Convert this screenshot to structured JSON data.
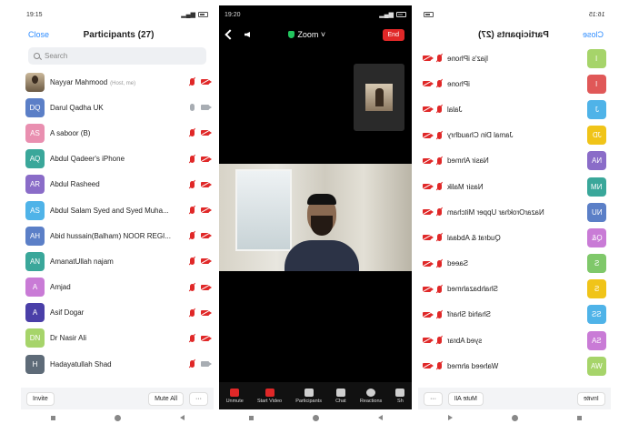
{
  "panel1": {
    "status": {
      "time": "19:15"
    },
    "header": {
      "close": "Close",
      "title": "Participants (27)"
    },
    "search": {
      "placeholder": "Search"
    },
    "participants": [
      {
        "name": "Nayyar Mahmood",
        "host": "(Host, me)",
        "initials": "",
        "color": "",
        "mic": "muted",
        "cam": "off"
      },
      {
        "name": "Darul Qadha UK",
        "initials": "DQ",
        "color": "#5b7fc7",
        "mic": "on",
        "cam": "on"
      },
      {
        "name": "A saboor (B)",
        "initials": "AS",
        "color": "#e98fb0",
        "mic": "muted",
        "cam": "off"
      },
      {
        "name": "Abdul Qadeer's iPhone",
        "initials": "AQ",
        "color": "#3aa79a",
        "mic": "muted",
        "cam": "off"
      },
      {
        "name": "Abdul Rasheed",
        "initials": "AR",
        "color": "#8a6cc8",
        "mic": "muted",
        "cam": "off"
      },
      {
        "name": "Abdul Salam Syed and Syed Muha...",
        "initials": "AS",
        "color": "#4fb3e8",
        "mic": "muted",
        "cam": "off"
      },
      {
        "name": "Abid hussain(Balham) NOOR REGI...",
        "initials": "AH",
        "color": "#5b7fc7",
        "mic": "muted",
        "cam": "off"
      },
      {
        "name": "AmanatUllah najam",
        "initials": "AN",
        "color": "#3aa79a",
        "mic": "muted",
        "cam": "off"
      },
      {
        "name": "Amjad",
        "initials": "A",
        "color": "#c97bd6",
        "mic": "muted",
        "cam": "off"
      },
      {
        "name": "Asif Dogar",
        "initials": "A",
        "color": "#4a3fa8",
        "mic": "muted",
        "cam": "off"
      },
      {
        "name": "Dr Nasir Ali",
        "initials": "DN",
        "color": "#a6d46a",
        "mic": "muted",
        "cam": "off"
      },
      {
        "name": "Hadayatullah Shad",
        "initials": "H",
        "color": "#5e6b78",
        "mic": "muted",
        "cam": "on"
      }
    ],
    "bottom": {
      "invite": "Invite",
      "mute_all": "Mute All",
      "more": "···"
    }
  },
  "panel2": {
    "status": {
      "time": "19:20"
    },
    "top": {
      "zoom": "Zoom ˅",
      "end": "End"
    },
    "toolbar": [
      {
        "label": "Unmute",
        "icon": "mic-off-icon"
      },
      {
        "label": "Start Video",
        "icon": "video-off-icon"
      },
      {
        "label": "Participants",
        "icon": "participants-icon"
      },
      {
        "label": "Chat",
        "icon": "chat-icon"
      },
      {
        "label": "Reactions",
        "icon": "reactions-icon"
      },
      {
        "label": "Sh",
        "icon": "share-icon"
      }
    ]
  },
  "panel3": {
    "status": {
      "time": "16:15"
    },
    "header": {
      "close": "Close",
      "title": "Participants (27)"
    },
    "participants": [
      {
        "name": "Ijaz's iPhone",
        "initials": "I",
        "color": "#a6d46a"
      },
      {
        "name": "iPhone",
        "initials": "I",
        "color": "#e05858"
      },
      {
        "name": "Jalal",
        "initials": "J",
        "color": "#4fb3e8"
      },
      {
        "name": "Jamal Din Chaudhry",
        "initials": "JD",
        "color": "#f0c419"
      },
      {
        "name": "Nasir Ahmed",
        "initials": "NA",
        "color": "#8a6cc8"
      },
      {
        "name": "Nasir Malik",
        "initials": "NM",
        "color": "#3aa79a"
      },
      {
        "name": "NazarOrokhar Upper Mitcham",
        "initials": "NU",
        "color": "#5b7fc7"
      },
      {
        "name": "Qudrat & Abdaal",
        "initials": "Q&",
        "color": "#c97bd6"
      },
      {
        "name": "Saeed",
        "initials": "S",
        "color": "#7fc86a"
      },
      {
        "name": "Shahbazahmed",
        "initials": "S",
        "color": "#f0c419"
      },
      {
        "name": "Shahid Sharif",
        "initials": "SS",
        "color": "#4fb3e8"
      },
      {
        "name": "syed Abrar",
        "initials": "SA",
        "color": "#c97bd6"
      },
      {
        "name": "Waheed ahmed",
        "initials": "WA",
        "color": "#a6d46a"
      }
    ],
    "bottom": {
      "invite": "Invite",
      "mute_all": "Mute All",
      "more": "···"
    }
  }
}
